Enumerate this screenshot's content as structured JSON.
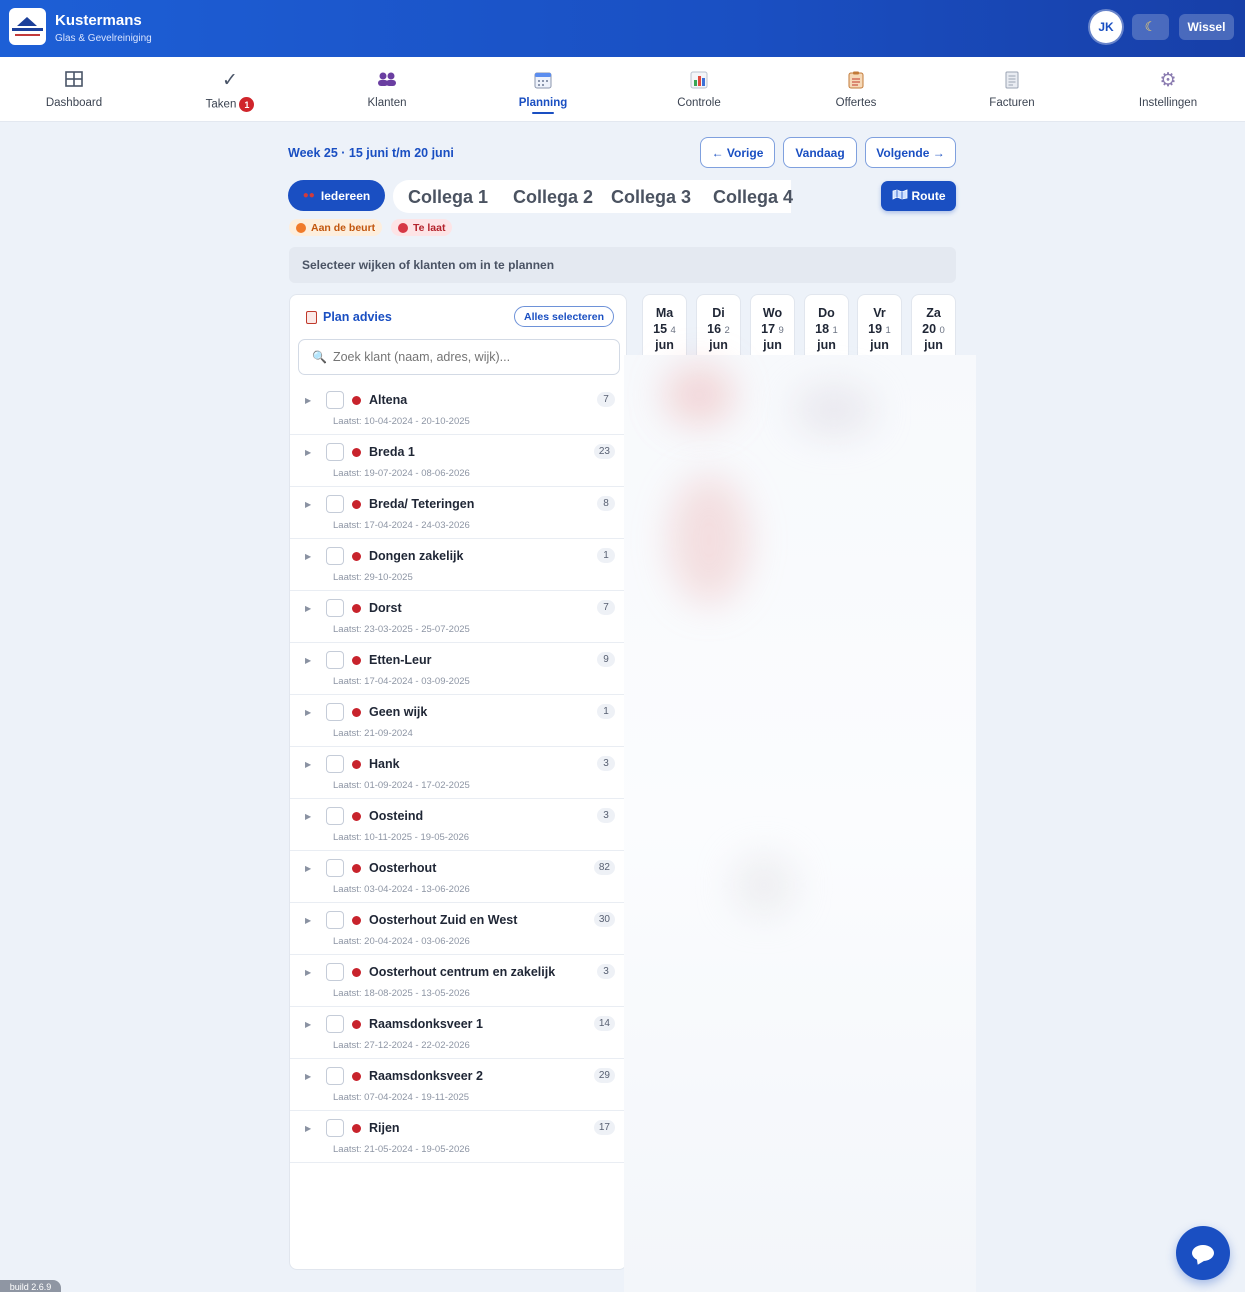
{
  "app": {
    "brand_name": "Kustermans",
    "brand_sub": "Glas & Gevelreiniging",
    "user_initials": "JK",
    "switch_label": "Wissel",
    "build": "build 2.6.9",
    "accent_color": "#1a4fc2"
  },
  "nav": {
    "items": [
      {
        "label": "Dashboard",
        "icon": "grid-icon"
      },
      {
        "label": "Taken",
        "icon": "check-icon",
        "badge": "1"
      },
      {
        "label": "Klanten",
        "icon": "people-icon"
      },
      {
        "label": "Planning",
        "icon": "calendar-icon",
        "active": true
      },
      {
        "label": "Controle",
        "icon": "chart-icon"
      },
      {
        "label": "Offertes",
        "icon": "clipboard-icon"
      },
      {
        "label": "Facturen",
        "icon": "receipt-icon"
      },
      {
        "label": "Instellingen",
        "icon": "gear-icon"
      }
    ]
  },
  "week": {
    "title": "Week 25 · 15 juni t/m 20 juni",
    "prev": "← Vorige",
    "today": "Vandaag",
    "next": "Volgende →"
  },
  "people": {
    "all": "Iedereen",
    "colleagues": [
      "Collega 1",
      "Collega 2",
      "Collega 3",
      "Collega 4"
    ],
    "route": "Route"
  },
  "legend": {
    "due": "Aan de beurt",
    "late": "Te laat",
    "due_color": "#f07a2a",
    "late_color": "#d63745"
  },
  "hint": "Selecteer wijken of klanten om in te plannen",
  "panel": {
    "title": "Plan advies",
    "select_all": "Alles selecteren",
    "search_placeholder": "Zoek klant (naam, adres, wijk)...",
    "rows": [
      {
        "name": "Altena",
        "count": "7",
        "last": "Laatst: 10-04-2024 - 20-10-2025"
      },
      {
        "name": "Breda 1",
        "count": "23",
        "last": "Laatst: 19-07-2024 - 08-06-2026"
      },
      {
        "name": "Breda/ Teteringen",
        "count": "8",
        "last": "Laatst: 17-04-2024 - 24-03-2026"
      },
      {
        "name": "Dongen zakelijk",
        "count": "1",
        "last": "Laatst: 29-10-2025"
      },
      {
        "name": "Dorst",
        "count": "7",
        "last": "Laatst: 23-03-2025 - 25-07-2025"
      },
      {
        "name": "Etten-Leur",
        "count": "9",
        "last": "Laatst: 17-04-2024 - 03-09-2025"
      },
      {
        "name": "Geen wijk",
        "count": "1",
        "last": "Laatst: 21-09-2024"
      },
      {
        "name": "Hank",
        "count": "3",
        "last": "Laatst: 01-09-2024 - 17-02-2025"
      },
      {
        "name": "Oosteind",
        "count": "3",
        "last": "Laatst: 10-11-2025 - 19-05-2026"
      },
      {
        "name": "Oosterhout",
        "count": "82",
        "last": "Laatst: 03-04-2024 - 13-06-2026"
      },
      {
        "name": "Oosterhout Zuid en West",
        "count": "30",
        "last": "Laatst: 20-04-2024 - 03-06-2026"
      },
      {
        "name": "Oosterhout centrum en zakelijk",
        "count": "3",
        "last": "Laatst: 18-08-2025 - 13-05-2026"
      },
      {
        "name": "Raamsdonksveer 1",
        "count": "14",
        "last": "Laatst: 27-12-2024 - 22-02-2026"
      },
      {
        "name": "Raamsdonksveer 2",
        "count": "29",
        "last": "Laatst: 07-04-2024 - 19-11-2025"
      },
      {
        "name": "Rijen",
        "count": "17",
        "last": "Laatst: 21-05-2024 - 19-05-2026"
      }
    ]
  },
  "days": [
    {
      "name": "Ma",
      "num": "15",
      "count": "4",
      "month": "jun"
    },
    {
      "name": "Di",
      "num": "16",
      "count": "2",
      "month": "jun"
    },
    {
      "name": "Wo",
      "num": "17",
      "count": "9",
      "month": "jun"
    },
    {
      "name": "Do",
      "num": "18",
      "count": "1",
      "month": "jun"
    },
    {
      "name": "Vr",
      "num": "19",
      "count": "1",
      "month": "jun"
    },
    {
      "name": "Za",
      "num": "20",
      "count": "0",
      "month": "jun"
    }
  ]
}
